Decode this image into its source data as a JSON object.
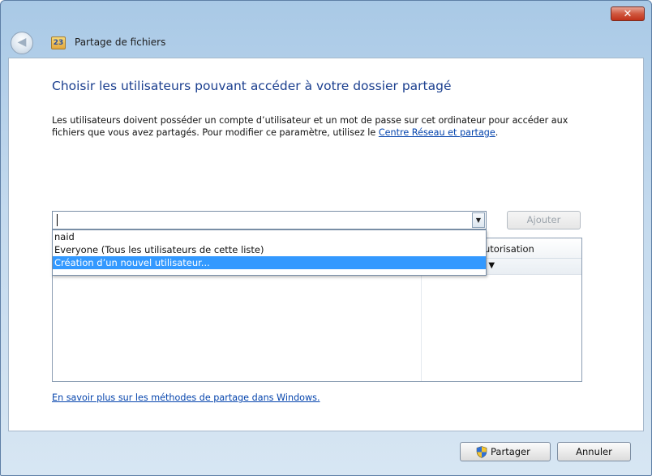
{
  "window": {
    "close_glyph": "✕",
    "back_glyph": "◀",
    "app_icon_text": "23",
    "app_title": "Partage de fichiers"
  },
  "main": {
    "heading": "Choisir les utilisateurs pouvant accéder à votre dossier partagé",
    "description_text": "Les utilisateurs doivent posséder un compte d’utilisateur et un mot de passe sur cet ordinateur pour accéder aux fichiers que vous avez partagés. Pour modifier ce paramètre, utilisez le ",
    "description_link": "Centre Réseau et partage",
    "description_end": "."
  },
  "user_combo": {
    "value": "",
    "arrow_glyph": "▼",
    "options": [
      "naid",
      "Everyone (Tous les utilisateurs de cette liste)",
      "Création d’un nouvel utilisateur..."
    ],
    "selected_index": 2
  },
  "add_button": {
    "label": "Ajouter",
    "enabled": false
  },
  "table": {
    "permission_header": "utorisation",
    "row_permission_arrow": "e ▼"
  },
  "learn_more_link": "En savoir plus sur les méthodes de partage dans Windows.",
  "footer": {
    "share_label": "Partager",
    "cancel_label": "Annuler"
  },
  "icons": {
    "close": "close-icon",
    "back": "back-arrow-icon",
    "app": "file-sharing-icon",
    "dropdown": "chevron-down-icon",
    "share": "uac-shield-icon"
  }
}
